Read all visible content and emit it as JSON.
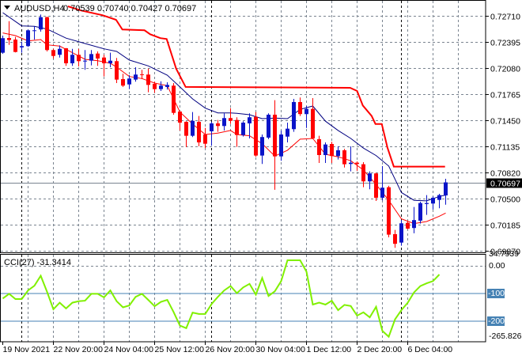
{
  "header": {
    "symbol": "AUDUSD,H4",
    "ohlc": "0.70539 0.70740 0.70427 0.70697",
    "menu_icon": "triangle-down-icon"
  },
  "colors": {
    "bull": "#0a14c8",
    "bear": "#ff0000",
    "ma_blue": "#000080",
    "ma_red": "#ff0000",
    "step_line": "#ff0000",
    "cci": "#80f000",
    "levels": "#4682b4",
    "grid": "#7a8490"
  },
  "chart_data": {
    "type": "candlestick",
    "title": "AUDUSD,H4",
    "ylim": [
      0.6987,
      0.7271
    ],
    "y_ticks": [
      "0.72710",
      "0.72395",
      "0.72080",
      "0.71765",
      "0.71450",
      "0.71135",
      "0.70820",
      "0.70500",
      "0.70185",
      "0.69870"
    ],
    "current_price": "0.70697",
    "candles": [
      [
        0.72264,
        0.72471,
        0.72251,
        0.7244
      ],
      [
        0.72442,
        0.72646,
        0.72359,
        0.72417
      ],
      [
        0.72423,
        0.72455,
        0.72268,
        0.72273
      ],
      [
        0.72328,
        0.72397,
        0.72264,
        0.72344
      ],
      [
        0.72344,
        0.72545,
        0.72334,
        0.72535
      ],
      [
        0.72526,
        0.72583,
        0.72423,
        0.72535
      ],
      [
        0.72545,
        0.72726,
        0.72519,
        0.72694
      ],
      [
        0.72694,
        0.727,
        0.7228,
        0.72296
      ],
      [
        0.72296,
        0.72311,
        0.72194,
        0.72225
      ],
      [
        0.72239,
        0.72353,
        0.72206,
        0.72311
      ],
      [
        0.72318,
        0.7232,
        0.72105,
        0.72136
      ],
      [
        0.72136,
        0.72311,
        0.72105,
        0.72239
      ],
      [
        0.72239,
        0.72311,
        0.72098,
        0.72162
      ],
      [
        0.72158,
        0.72296,
        0.72057,
        0.72168
      ],
      [
        0.72168,
        0.72296,
        0.72111,
        0.72248
      ],
      [
        0.72254,
        0.7228,
        0.72105,
        0.72194
      ],
      [
        0.72206,
        0.72239,
        0.71977,
        0.72136
      ],
      [
        0.72136,
        0.72264,
        0.72089,
        0.72168
      ],
      [
        0.72162,
        0.72201,
        0.71897,
        0.71939
      ],
      [
        0.71945,
        0.72009,
        0.7185,
        0.71866
      ],
      [
        0.71881,
        0.71993,
        0.71824,
        0.71952
      ],
      [
        0.71939,
        0.72089,
        0.71914,
        0.72
      ],
      [
        0.72003,
        0.72057,
        0.71945,
        0.71996
      ],
      [
        0.72,
        0.72072,
        0.71786,
        0.71875
      ],
      [
        0.71888,
        0.71914,
        0.7178,
        0.71824
      ],
      [
        0.71824,
        0.71919,
        0.71802,
        0.71866
      ],
      [
        0.7185,
        0.71907,
        0.71818,
        0.71875
      ],
      [
        0.71866,
        0.71897,
        0.71515,
        0.71537
      ],
      [
        0.71553,
        0.71556,
        0.71324,
        0.71419
      ],
      [
        0.71429,
        0.71436,
        0.71123,
        0.7126
      ],
      [
        0.7126,
        0.71547,
        0.71245,
        0.71441
      ],
      [
        0.71429,
        0.71499,
        0.71133,
        0.7118
      ],
      [
        0.71276,
        0.71355,
        0.71111,
        0.71164
      ],
      [
        0.71314,
        0.71429,
        0.71139,
        0.7141
      ],
      [
        0.7141,
        0.71451,
        0.71308,
        0.71378
      ],
      [
        0.71378,
        0.71531,
        0.71324,
        0.71474
      ],
      [
        0.71474,
        0.71594,
        0.71403,
        0.71441
      ],
      [
        0.71451,
        0.71484,
        0.71126,
        0.71269
      ],
      [
        0.71269,
        0.71436,
        0.7125,
        0.71419
      ],
      [
        0.7141,
        0.71531,
        0.71228,
        0.71484
      ],
      [
        0.71489,
        0.71547,
        0.71006,
        0.71021
      ],
      [
        0.71021,
        0.71276,
        0.70919,
        0.71245
      ],
      [
        0.71238,
        0.71531,
        0.71219,
        0.71515
      ],
      [
        0.71515,
        0.7169,
        0.70607,
        0.71011
      ],
      [
        0.71011,
        0.71324,
        0.70958,
        0.71276
      ],
      [
        0.7125,
        0.71419,
        0.7118,
        0.71346
      ],
      [
        0.7134,
        0.71706,
        0.71308,
        0.71668
      ],
      [
        0.71668,
        0.71723,
        0.71499,
        0.71522
      ],
      [
        0.71522,
        0.7162,
        0.71355,
        0.71585
      ],
      [
        0.71585,
        0.71716,
        0.71219,
        0.71228
      ],
      [
        0.71219,
        0.7126,
        0.70932,
        0.71027
      ],
      [
        0.71027,
        0.7118,
        0.70932,
        0.71155
      ],
      [
        0.71161,
        0.71187,
        0.70932,
        0.71015
      ],
      [
        0.71015,
        0.71133,
        0.70973,
        0.71085
      ],
      [
        0.71085,
        0.71101,
        0.70877,
        0.70916
      ],
      [
        0.70919,
        0.71133,
        0.7083,
        0.70935
      ],
      [
        0.70935,
        0.70951,
        0.70836,
        0.70919
      ],
      [
        0.70916,
        0.70941,
        0.70638,
        0.70709
      ],
      [
        0.70709,
        0.7083,
        0.70614,
        0.70805
      ],
      [
        0.70805,
        0.70814,
        0.70473,
        0.70511
      ],
      [
        0.70511,
        0.70894,
        0.7048,
        0.70633
      ],
      [
        0.70638,
        0.70655,
        0.70033,
        0.70065
      ],
      [
        0.70071,
        0.70122,
        0.69906,
        0.69954
      ],
      [
        0.69969,
        0.70241,
        0.69931,
        0.70202
      ],
      [
        0.70208,
        0.70234,
        0.70129,
        0.70138
      ],
      [
        0.70145,
        0.70399,
        0.70081,
        0.70241
      ],
      [
        0.70234,
        0.70463,
        0.70199,
        0.70447
      ],
      [
        0.70435,
        0.70543,
        0.70304,
        0.70447
      ],
      [
        0.70441,
        0.70527,
        0.70368,
        0.70511
      ],
      [
        0.70485,
        0.70559,
        0.70384,
        0.70543
      ],
      [
        0.70539,
        0.7074,
        0.70427,
        0.70697
      ]
    ],
    "ma_blue": [
      [
        0,
        0.72748
      ],
      [
        3,
        0.72589
      ],
      [
        5,
        0.72583
      ],
      [
        7,
        0.7255
      ],
      [
        10,
        0.7244
      ],
      [
        13,
        0.72375
      ],
      [
        16,
        0.72311
      ],
      [
        18,
        0.7228
      ],
      [
        20,
        0.72175
      ],
      [
        23,
        0.72105
      ],
      [
        26,
        0.71993
      ],
      [
        28,
        0.7185
      ],
      [
        30,
        0.71706
      ],
      [
        32,
        0.71594
      ],
      [
        34,
        0.71537
      ],
      [
        36,
        0.71537
      ],
      [
        37,
        0.71531
      ],
      [
        39,
        0.71515
      ],
      [
        41,
        0.71467
      ],
      [
        43,
        0.71474
      ],
      [
        45,
        0.71467
      ],
      [
        47,
        0.71579
      ],
      [
        49,
        0.7162
      ],
      [
        51,
        0.71436
      ],
      [
        53,
        0.71324
      ],
      [
        55,
        0.71228
      ],
      [
        57,
        0.71111
      ],
      [
        59,
        0.71021
      ],
      [
        61,
        0.70894
      ],
      [
        63,
        0.70575
      ],
      [
        65,
        0.7048
      ],
      [
        67,
        0.70473
      ],
      [
        69,
        0.70527
      ],
      [
        70,
        0.70543
      ]
    ],
    "ma_red": [
      [
        0,
        0.72503
      ],
      [
        2,
        0.72471
      ],
      [
        4,
        0.72407
      ],
      [
        6,
        0.72423
      ],
      [
        7,
        0.72359
      ],
      [
        9,
        0.72344
      ],
      [
        11,
        0.72264
      ],
      [
        13,
        0.72184
      ],
      [
        15,
        0.72168
      ],
      [
        17,
        0.72136
      ],
      [
        18,
        0.72089
      ],
      [
        20,
        0.71977
      ],
      [
        22,
        0.71952
      ],
      [
        24,
        0.71897
      ],
      [
        26,
        0.71866
      ],
      [
        28,
        0.71547
      ],
      [
        30,
        0.71403
      ],
      [
        32,
        0.71276
      ],
      [
        34,
        0.71292
      ],
      [
        36,
        0.71324
      ],
      [
        37,
        0.71276
      ],
      [
        39,
        0.7126
      ],
      [
        41,
        0.71164
      ],
      [
        43,
        0.71015
      ],
      [
        45,
        0.71085
      ],
      [
        47,
        0.71219
      ],
      [
        49,
        0.71228
      ],
      [
        51,
        0.71037
      ],
      [
        53,
        0.71006
      ],
      [
        55,
        0.70958
      ],
      [
        57,
        0.70846
      ],
      [
        59,
        0.70671
      ],
      [
        61,
        0.7048
      ],
      [
        63,
        0.70256
      ],
      [
        65,
        0.70199
      ],
      [
        67,
        0.70224
      ],
      [
        69,
        0.70288
      ],
      [
        70,
        0.70326
      ]
    ],
    "step_line": [
      [
        10.3,
        0.72825
      ],
      [
        12.4,
        0.72774
      ],
      [
        15.8,
        0.72717
      ],
      [
        17.9,
        0.72662
      ],
      [
        18.9,
        0.72545
      ],
      [
        22.4,
        0.72535
      ],
      [
        23.3,
        0.72487
      ],
      [
        24.9,
        0.7244
      ],
      [
        25.9,
        0.7243
      ],
      [
        27.4,
        0.72072
      ],
      [
        28.9,
        0.7185
      ],
      [
        54.9,
        0.7184
      ],
      [
        56,
        0.71802
      ],
      [
        56.9,
        0.71627
      ],
      [
        58.3,
        0.71499
      ],
      [
        58.9,
        0.71403
      ],
      [
        59.9,
        0.71403
      ],
      [
        60.8,
        0.71116
      ],
      [
        61.8,
        0.70887
      ],
      [
        69.9,
        0.70887
      ]
    ],
    "x_labels": [
      [
        0,
        "19 Nov 2021"
      ],
      [
        8,
        "22 Nov 20:00"
      ],
      [
        16,
        "24 Nov 04:00"
      ],
      [
        24,
        "25 Nov 12:00"
      ],
      [
        32,
        "26 Nov 20:00"
      ],
      [
        40,
        "30 Nov 04:00"
      ],
      [
        48,
        "1 Dec 12:00"
      ],
      [
        56,
        "2 Dec 20:00"
      ],
      [
        64,
        "6 Dec 04:00"
      ]
    ],
    "day_separators": [
      3,
      33,
      63
    ],
    "cci": {
      "label": "CCI(27) -31.3414",
      "ylim": [
        -265.8267,
        34.7939
      ],
      "y_labels": [
        "34.7939",
        "0.00",
        "-100",
        "-200",
        "-265.8267"
      ],
      "levels": [
        -100,
        -200
      ],
      "values": [
        -118,
        -101,
        -120,
        -120,
        -89,
        -72,
        -36,
        -94,
        -157,
        -133,
        -154,
        -133,
        -128,
        -126,
        -101,
        -101,
        -114,
        -89,
        -128,
        -150,
        -143,
        -112,
        -101,
        -123,
        -146,
        -130,
        -123,
        -167,
        -216,
        -225,
        -169,
        -174,
        -174,
        -138,
        -112,
        -89,
        -73,
        -99,
        -78,
        -65,
        -104,
        -44,
        -109,
        -92,
        -55,
        20,
        20,
        20,
        -21,
        -140,
        -133,
        -140,
        -126,
        -160,
        -141,
        -145,
        -180,
        -168,
        -186,
        -148,
        -235,
        -256,
        -193,
        -160,
        -133,
        -96,
        -73,
        -63,
        -55,
        -31.34
      ]
    }
  }
}
